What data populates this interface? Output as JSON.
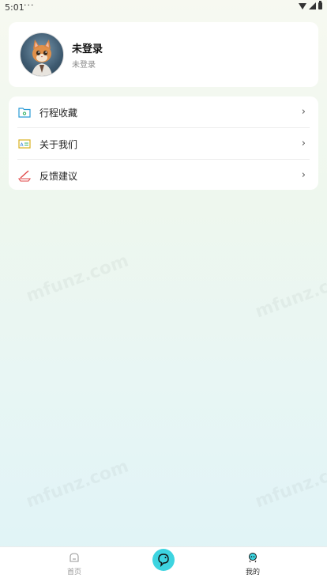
{
  "status_bar": {
    "time": "5:01",
    "dots": "···"
  },
  "profile": {
    "name": "未登录",
    "subtitle": "未登录"
  },
  "menu": [
    {
      "label": "行程收藏",
      "icon": "folder-icon"
    },
    {
      "label": "关于我们",
      "icon": "id-card-icon"
    },
    {
      "label": "反馈建议",
      "icon": "pen-icon"
    }
  ],
  "tabs": [
    {
      "label": "首页",
      "icon": "home-icon"
    },
    {
      "label": "",
      "icon": "chat-bubble-icon"
    },
    {
      "label": "我的",
      "icon": "profile-icon"
    }
  ],
  "watermark": "mfunz.com",
  "colors": {
    "accent": "#3dd4e0",
    "card": "#ffffff"
  }
}
